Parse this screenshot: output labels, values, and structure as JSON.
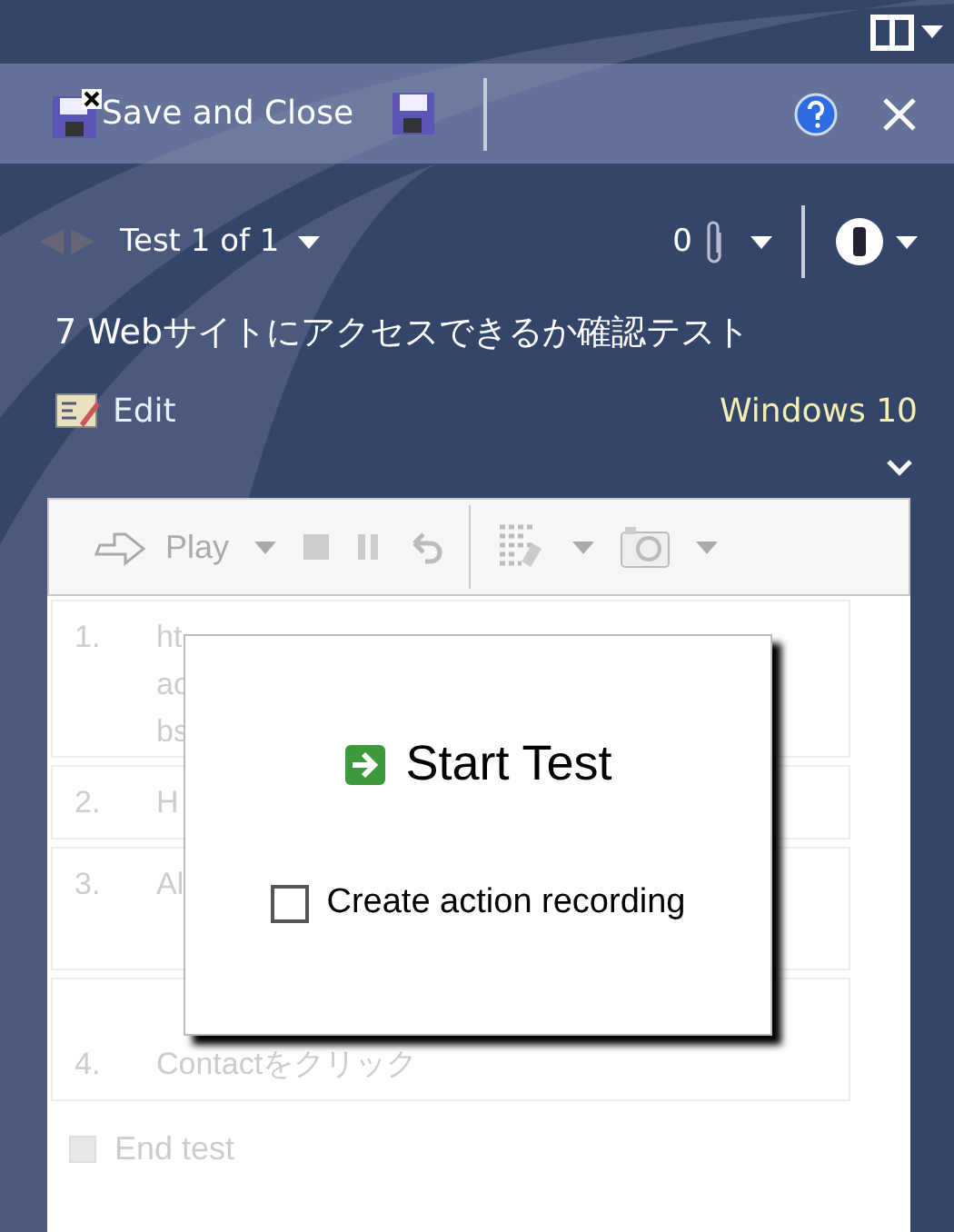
{
  "toolbar": {
    "save_close": "Save and Close"
  },
  "navigator": {
    "label": "Test 1 of 1",
    "attachments": "0"
  },
  "test": {
    "title": "7 Webサイトにアクセスできるか確認テスト",
    "edit": "Edit",
    "configuration": "Windows 10"
  },
  "runner": {
    "disabled": true,
    "play": "Play",
    "steps": [
      {
        "number": "1.",
        "lines": [
          "ht",
          "ac",
          "bs"
        ]
      },
      {
        "number": "2.",
        "lines": [
          "H"
        ]
      },
      {
        "number": "3.",
        "lines": [
          "Al"
        ]
      },
      {
        "number": "4.",
        "lines": [
          "Contactをクリック"
        ]
      }
    ],
    "end": {
      "label": "End test",
      "checked": false
    }
  },
  "dialog": {
    "title": "Start Test",
    "option": {
      "label": "Create action recording",
      "checked": false
    }
  }
}
